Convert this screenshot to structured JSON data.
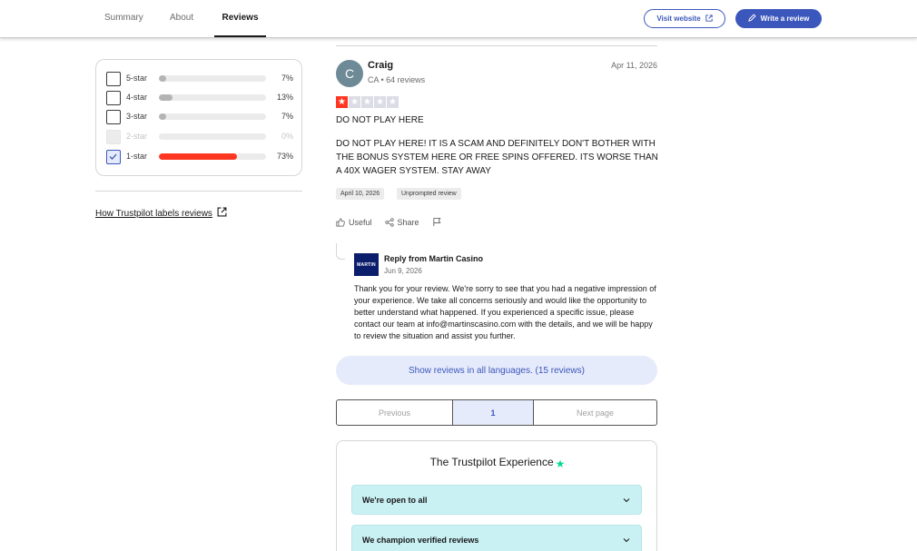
{
  "nav": {
    "tabs": [
      {
        "label": "Summary",
        "active": false
      },
      {
        "label": "About",
        "active": false
      },
      {
        "label": "Reviews",
        "active": true
      }
    ],
    "visit_website": "Visit website",
    "write_review": "Write a review"
  },
  "filters": {
    "rows": [
      {
        "label": "5-star",
        "percent": 7,
        "percent_text": "7%",
        "checked": false,
        "disabled": false
      },
      {
        "label": "4-star",
        "percent": 13,
        "percent_text": "13%",
        "checked": false,
        "disabled": false
      },
      {
        "label": "3-star",
        "percent": 7,
        "percent_text": "7%",
        "checked": false,
        "disabled": false
      },
      {
        "label": "2-star",
        "percent": 0,
        "percent_text": "0%",
        "checked": false,
        "disabled": true
      },
      {
        "label": "1-star",
        "percent": 73,
        "percent_text": "73%",
        "checked": true,
        "disabled": false
      }
    ],
    "how_labels_link": "How Trustpilot labels reviews"
  },
  "review": {
    "avatar_initial": "C",
    "name": "Craig",
    "meta": "CA • 64 reviews",
    "date": "Apr 11, 2026",
    "rating": 1,
    "max_rating": 5,
    "title": "DO NOT PLAY HERE",
    "body": "DO NOT PLAY HERE! IT IS A SCAM AND DEFINITELY DON'T BOTHER WITH THE BONUS SYSTEM HERE OR FREE SPINS OFFERED. ITS WORSE THAN A 40X WAGER SYSTEM. STAY AWAY",
    "tags": [
      "April 10, 2026",
      "Unprompted review"
    ],
    "actions": {
      "useful": "Useful",
      "share": "Share"
    }
  },
  "reply": {
    "logo_text": "MARTIN",
    "from": "Reply from Martin Casino",
    "date": "Jun 9, 2026",
    "body": "Thank you for your review. We're sorry to see that you had a negative impression of your experience. We take all concerns seriously and would like the opportunity to better understand what happened. If you experienced a specific issue, please contact our team at info@martinscasino.com with the details, and we will be happy to review the situation and assist you further."
  },
  "show_languages": "Show reviews in all languages. (15 reviews)",
  "pagination": {
    "previous": "Previous",
    "current": "1",
    "next": "Next page"
  },
  "experience": {
    "title": "The Trustpilot Experience",
    "items": [
      "We're open to all",
      "We champion verified reviews"
    ]
  },
  "colors": {
    "brand_blue": "#3c57bc",
    "star_red": "#ff3722",
    "accent_green": "#04da8d",
    "accordion_bg": "#c9f0f3"
  }
}
